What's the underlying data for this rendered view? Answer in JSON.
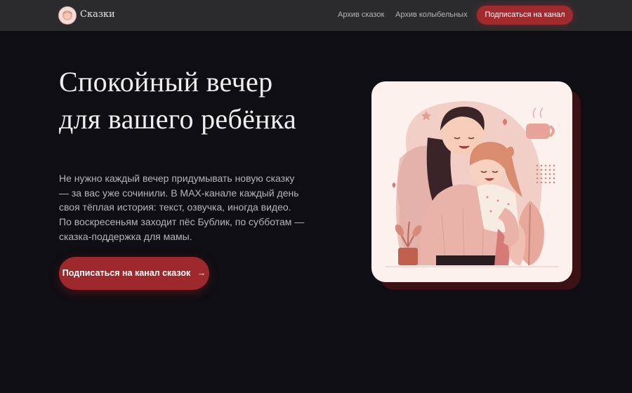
{
  "nav": {
    "brand": "Сказки",
    "links": [
      "Архив сказок",
      "Архив колыбельных"
    ],
    "cta": "Подписаться на канал"
  },
  "hero": {
    "title": "Спокойный вечер для вашего ребёнка",
    "text": "Не нужно каждый вечер придумывать новую сказку — за вас уже сочинили. В MAX-канале каждый день своя тёплая история: текст, озвучка, иногда видео. По воскресеньям заходит пёс Бублик, по субботам — сказка-поддержка для мамы.",
    "cta": "Подписаться на канал сказок",
    "cta_icon": "arrow-right-icon"
  },
  "illustration": {
    "icon": "mother-daughter-hug-illustration"
  },
  "colors": {
    "background": "#0f0e12",
    "nav": "#2b2b2d",
    "accent": "#a12a2e",
    "card": "#fcf1ed"
  }
}
